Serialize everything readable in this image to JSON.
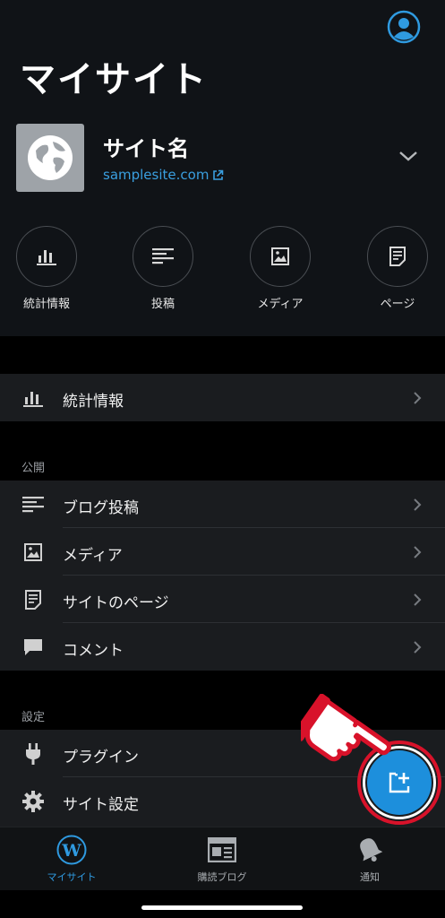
{
  "header": {
    "title": "マイサイト",
    "avatar_icon": "account-circle-icon"
  },
  "site": {
    "name": "サイト名",
    "url": "samplesite.com",
    "thumb_icon": "globe-icon"
  },
  "quick_actions": [
    {
      "label": "統計情報",
      "icon": "stats-icon"
    },
    {
      "label": "投稿",
      "icon": "posts-icon"
    },
    {
      "label": "メディア",
      "icon": "media-icon"
    },
    {
      "label": "ページ",
      "icon": "pages-icon"
    }
  ],
  "stats_row": {
    "label": "統計情報",
    "icon": "stats-icon"
  },
  "publish_section": {
    "label": "公開",
    "items": [
      {
        "label": "ブログ投稿",
        "icon": "posts-icon"
      },
      {
        "label": "メディア",
        "icon": "media-icon"
      },
      {
        "label": "サイトのページ",
        "icon": "pages-icon"
      },
      {
        "label": "コメント",
        "icon": "comment-icon"
      }
    ]
  },
  "settings_section": {
    "label": "設定",
    "items": [
      {
        "label": "プラグイン",
        "icon": "plugin-icon"
      },
      {
        "label": "サイト設定",
        "icon": "gear-icon"
      }
    ]
  },
  "fab": {
    "icon": "new-post-icon",
    "highlight_color": "#d8122a"
  },
  "tabbar": {
    "items": [
      {
        "label": "マイサイト",
        "icon": "wordpress-logo-icon",
        "active": true
      },
      {
        "label": "購読ブログ",
        "icon": "reader-icon",
        "active": false
      },
      {
        "label": "通知",
        "icon": "bell-icon",
        "active": false
      }
    ]
  },
  "colors": {
    "accent": "#2f9ae0",
    "background": "#000000",
    "card": "#1a1c1f"
  }
}
